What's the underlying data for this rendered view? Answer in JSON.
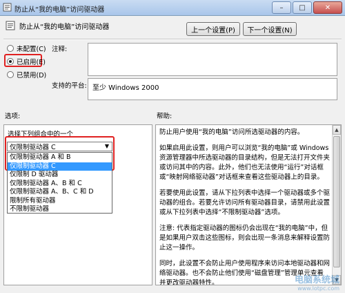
{
  "window": {
    "title": "防止从“我的电脑”访问驱动器",
    "minimize": "–",
    "maximize": "□",
    "close": "✕"
  },
  "header": {
    "setting_title": "防止从“我的电脑”访问驱动器",
    "prev_button": "上一个设置(P)",
    "next_button": "下一个设置(N)"
  },
  "state": {
    "options": [
      {
        "label": "未配置(C)",
        "selected": false
      },
      {
        "label": "已启用(E)",
        "selected": true
      },
      {
        "label": "已禁用(D)",
        "selected": false
      }
    ]
  },
  "comment": {
    "label": "注释:",
    "value": ""
  },
  "platform": {
    "label": "支持的平台:",
    "value": "至少 Windows 2000"
  },
  "options_section": {
    "label": "选项:",
    "combo_label": "选择下列组合中的一个",
    "combo_value": "仅限制驱动器 C",
    "dropdown": [
      {
        "label": "仅限制驱动器 A 和 B",
        "selected": false
      },
      {
        "label": "仅限制驱动器 C",
        "selected": true
      },
      {
        "label": "仅限制 D 驱动器",
        "selected": false
      },
      {
        "label": "仅限制驱动器 A、B 和 C",
        "selected": false
      },
      {
        "label": "仅限制驱动器 A、B、C 和 D",
        "selected": false
      },
      {
        "label": "限制所有驱动器",
        "selected": false
      },
      {
        "label": "不限制驱动器",
        "selected": false
      }
    ]
  },
  "help_section": {
    "label": "帮助:",
    "paragraphs": [
      "防止用户使用“我的电脑”访问所选驱动器的内容。",
      "如果启用此设置，则用户可以浏览“我的电脑”或 Windows 资源管理器中所选驱动器的目录结构，但是无法打开文件夹或访问其中的内容。此外，他们也无法使用“运行”对话框或“映射网络驱动器”对话框来查看这些驱动器上的目录。",
      "若要使用此设置，请从下拉列表中选择一个驱动器或多个驱动器的组合。若要允许访问所有驱动器目录，请禁用此设置或从下拉列表中选择“不限制驱动器”选项。",
      "注意: 代表指定驱动器的图标仍会出现在“我的电脑”中，但是如果用户双击这些图标，则会出现一条消息来解释设置防止这一操作。",
      "同时，此设置不会防止用户使用程序来访问本地驱动器和网络驱动器。也不会防止他们使用“磁盘管理”管理单元查看并更改驱动器特性。"
    ]
  },
  "watermark": {
    "line1": "电脑系统城",
    "line2": "www.lotpc.com"
  },
  "colors": {
    "highlight_red": "#e02020",
    "selection_blue": "#3399ff"
  }
}
